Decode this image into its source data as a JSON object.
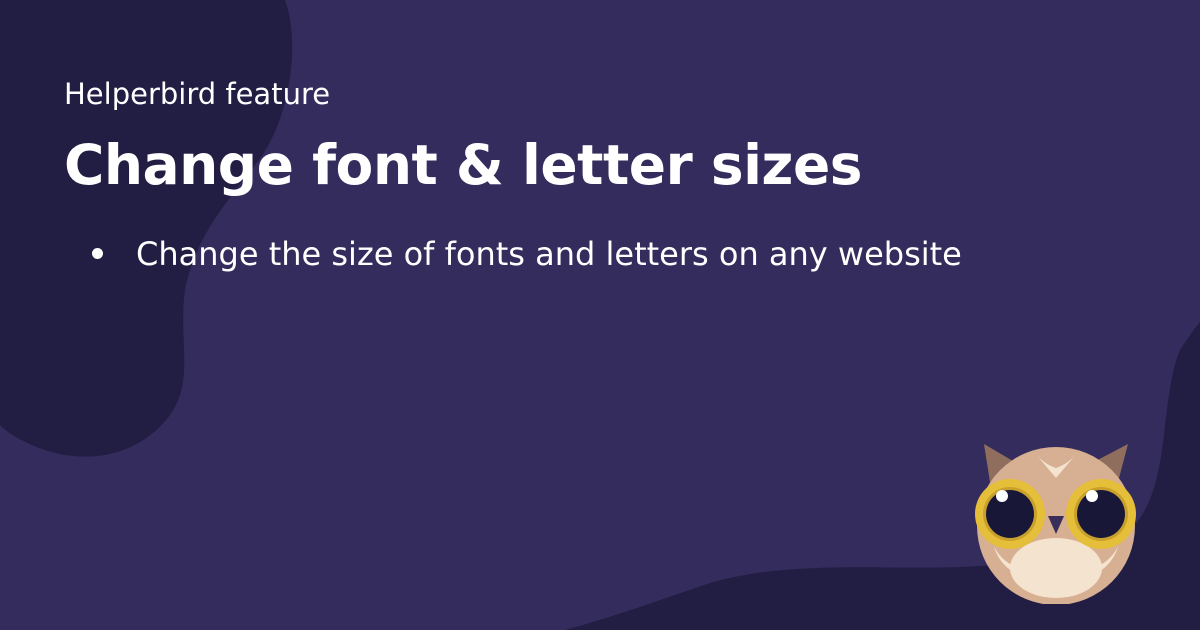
{
  "header": {
    "eyebrow": "Helperbird feature",
    "title": "Change font & letter sizes"
  },
  "features": [
    {
      "text": "Change the size of fonts and letters on any website"
    }
  ],
  "mascot": {
    "icon": "owl-icon"
  },
  "colors": {
    "background": "#332c5c",
    "blob": "#221d43",
    "text": "#ffffff",
    "owl_face": "#d7af92",
    "owl_ring": "#e5bf39",
    "owl_eye": "#181738"
  }
}
